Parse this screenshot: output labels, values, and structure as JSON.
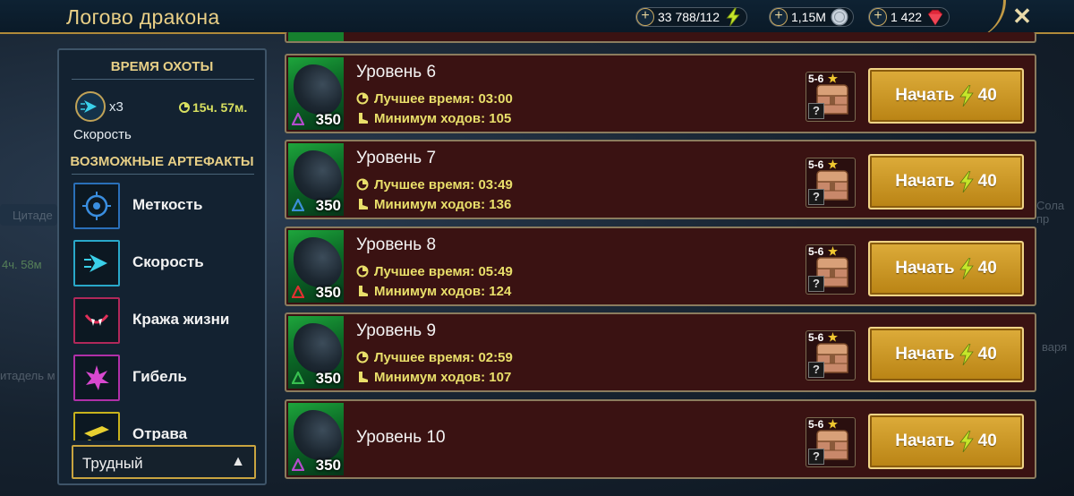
{
  "header": {
    "title": "Логово дракона",
    "close_icon": "close-icon"
  },
  "resources": [
    {
      "value": "33 788/112",
      "icon": "energy-lightning-icon"
    },
    {
      "value": "1,15M",
      "icon": "silver-coin-icon"
    },
    {
      "value": "1 422",
      "icon": "gem-icon"
    }
  ],
  "background_hints": [
    "Цитаде",
    "4ч. 58м",
    "итадель м",
    "Сола пр",
    "варя"
  ],
  "sidebar": {
    "hunt_title": "ВРЕМЯ ОХОТЫ",
    "hunt_multiplier": "x3",
    "hunt_timer": "15ч. 57м.",
    "hunt_set_label": "Скорость",
    "artifacts_title": "ВОЗМОЖНЫЕ АРТЕФАКТЫ",
    "artifacts": [
      {
        "label": "Меткость",
        "icon": "accuracy-icon",
        "color": "#2a6fb8"
      },
      {
        "label": "Скорость",
        "icon": "speed-icon",
        "color": "#29a8c9"
      },
      {
        "label": "Кража жизни",
        "icon": "lifesteal-icon",
        "color": "#b0285a"
      },
      {
        "label": "Гибель",
        "icon": "destroy-icon",
        "color": "#b030a8"
      },
      {
        "label": "Отрава",
        "icon": "poison-icon",
        "color": "#c8b21c"
      }
    ],
    "difficulty": "Трудный"
  },
  "levels": [
    {
      "name": "Уровень 6",
      "power": "350",
      "best_time_label": "Лучшее время: 03:00",
      "min_turns_label": "Минимум ходов: 105",
      "reward_range": "5-6",
      "reward_unknown": "?",
      "start_label": "Начать",
      "cost": "40",
      "affinity_color": "#b44ccc"
    },
    {
      "name": "Уровень 7",
      "power": "350",
      "best_time_label": "Лучшее время: 03:49",
      "min_turns_label": "Минимум ходов: 136",
      "reward_range": "5-6",
      "reward_unknown": "?",
      "start_label": "Начать",
      "cost": "40",
      "affinity_color": "#3c8fd8"
    },
    {
      "name": "Уровень 8",
      "power": "350",
      "best_time_label": "Лучшее время: 05:49",
      "min_turns_label": "Минимум ходов: 124",
      "reward_range": "5-6",
      "reward_unknown": "?",
      "start_label": "Начать",
      "cost": "40",
      "affinity_color": "#e03030"
    },
    {
      "name": "Уровень 9",
      "power": "350",
      "best_time_label": "Лучшее время: 02:59",
      "min_turns_label": "Минимум ходов: 107",
      "reward_range": "5-6",
      "reward_unknown": "?",
      "start_label": "Начать",
      "cost": "40",
      "affinity_color": "#38c050"
    },
    {
      "name": "Уровень 10",
      "power": "350",
      "reward_range": "5-6",
      "reward_unknown": "?",
      "start_label": "Начать",
      "cost": "40",
      "affinity_color": "#b44ccc"
    }
  ]
}
